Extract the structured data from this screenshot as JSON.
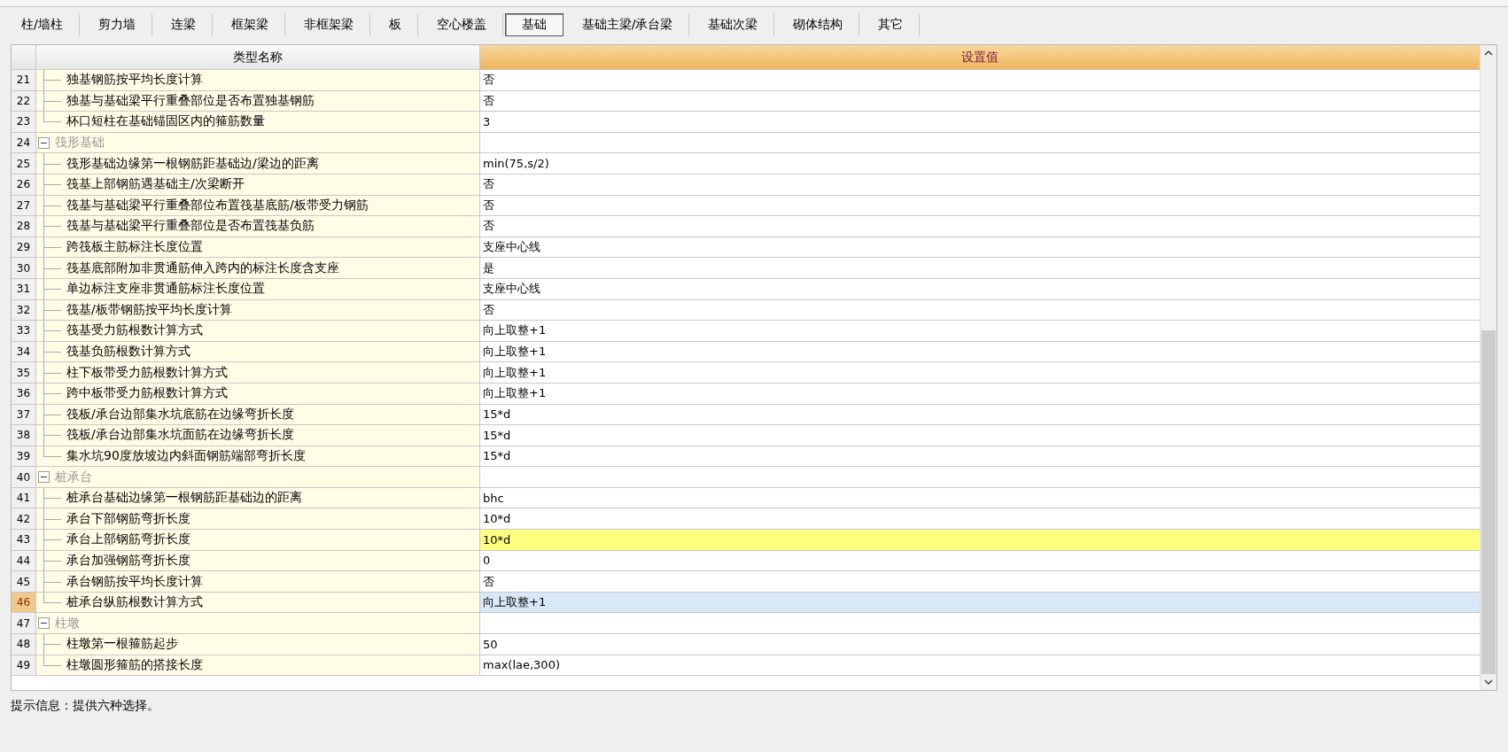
{
  "toolbar_tabs": [
    {
      "label": "柱/墙柱",
      "selected": false
    },
    {
      "label": "剪力墙",
      "selected": false
    },
    {
      "label": "连梁",
      "selected": false
    },
    {
      "label": "框架梁",
      "selected": false
    },
    {
      "label": "非框架梁",
      "selected": false
    },
    {
      "label": "板",
      "selected": false
    },
    {
      "label": "空心楼盖",
      "selected": false
    },
    {
      "label": "基础",
      "selected": true
    },
    {
      "label": "基础主梁/承台梁",
      "selected": false
    },
    {
      "label": "基础次梁",
      "selected": false
    },
    {
      "label": "砌体结构",
      "selected": false
    },
    {
      "label": "其它",
      "selected": false
    }
  ],
  "table": {
    "columns": [
      "类型名称",
      "设置值"
    ],
    "rows": [
      {
        "kind": "item",
        "number": "21",
        "name": "独基钢筋按平均长度计算",
        "value": "否",
        "selected": false,
        "highlighted": false
      },
      {
        "kind": "item",
        "number": "22",
        "name": "独基与基础梁平行重叠部位是否布置独基钢筋",
        "value": "否",
        "selected": false,
        "highlighted": false
      },
      {
        "kind": "item",
        "number": "23",
        "name": "杯口短柱在基础锚固区内的箍筋数量",
        "value": "3",
        "selected": false,
        "highlighted": false
      },
      {
        "kind": "group",
        "number": "24",
        "name": "筏形基础",
        "expanded": true,
        "selected": false,
        "children": [
          {
            "kind": "item",
            "number": "25",
            "name": "筏形基础边缘第一根钢筋距基础边/梁边的距离",
            "value": "min(75,s/2)",
            "selected": false,
            "highlighted": false
          },
          {
            "kind": "item",
            "number": "26",
            "name": "筏基上部钢筋遇基础主/次梁断开",
            "value": "否",
            "selected": false,
            "highlighted": false
          },
          {
            "kind": "item",
            "number": "27",
            "name": "筏基与基础梁平行重叠部位布置筏基底筋/板带受力钢筋",
            "value": "否",
            "selected": false,
            "highlighted": false
          },
          {
            "kind": "item",
            "number": "28",
            "name": "筏基与基础梁平行重叠部位是否布置筏基负筋",
            "value": "否",
            "selected": false,
            "highlighted": false
          },
          {
            "kind": "item",
            "number": "29",
            "name": "跨筏板主筋标注长度位置",
            "value": "支座中心线",
            "selected": false,
            "highlighted": false
          },
          {
            "kind": "item",
            "number": "30",
            "name": "筏基底部附加非贯通筋伸入跨内的标注长度含支座",
            "value": "是",
            "selected": false,
            "highlighted": false
          },
          {
            "kind": "item",
            "number": "31",
            "name": "单边标注支座非贯通筋标注长度位置",
            "value": "支座中心线",
            "selected": false,
            "highlighted": false
          },
          {
            "kind": "item",
            "number": "32",
            "name": "筏基/板带钢筋按平均长度计算",
            "value": "否",
            "selected": false,
            "highlighted": false
          },
          {
            "kind": "item",
            "number": "33",
            "name": "筏基受力筋根数计算方式",
            "value": "向上取整+1",
            "selected": false,
            "highlighted": false
          },
          {
            "kind": "item",
            "number": "34",
            "name": "筏基负筋根数计算方式",
            "value": "向上取整+1",
            "selected": false,
            "highlighted": false
          },
          {
            "kind": "item",
            "number": "35",
            "name": "柱下板带受力筋根数计算方式",
            "value": "向上取整+1",
            "selected": false,
            "highlighted": false
          },
          {
            "kind": "item",
            "number": "36",
            "name": "跨中板带受力筋根数计算方式",
            "value": "向上取整+1",
            "selected": false,
            "highlighted": false
          },
          {
            "kind": "item",
            "number": "37",
            "name": "筏板/承台边部集水坑底筋在边缘弯折长度",
            "value": "15*d",
            "selected": false,
            "highlighted": false
          },
          {
            "kind": "item",
            "number": "38",
            "name": "筏板/承台边部集水坑面筋在边缘弯折长度",
            "value": "15*d",
            "selected": false,
            "highlighted": false
          },
          {
            "kind": "item",
            "number": "39",
            "name": "集水坑90度放坡边内斜面钢筋端部弯折长度",
            "value": "15*d",
            "selected": false,
            "highlighted": false
          }
        ]
      },
      {
        "kind": "group",
        "number": "40",
        "name": "桩承台",
        "expanded": true,
        "selected": false,
        "children": [
          {
            "kind": "item",
            "number": "41",
            "name": "桩承台基础边缘第一根钢筋距基础边的距离",
            "value": "bhc",
            "selected": false,
            "highlighted": false
          },
          {
            "kind": "item",
            "number": "42",
            "name": "承台下部钢筋弯折长度",
            "value": "10*d",
            "selected": false,
            "highlighted": false
          },
          {
            "kind": "item",
            "number": "43",
            "name": "承台上部钢筋弯折长度",
            "value": "10*d",
            "selected": false,
            "highlighted": true
          },
          {
            "kind": "item",
            "number": "44",
            "name": "承台加强钢筋弯折长度",
            "value": "0",
            "selected": false,
            "highlighted": false
          },
          {
            "kind": "item",
            "number": "45",
            "name": "承台钢筋按平均长度计算",
            "value": "否",
            "selected": false,
            "highlighted": false
          },
          {
            "kind": "item",
            "number": "46",
            "name": "桩承台纵筋根数计算方式",
            "value": "向上取整+1",
            "selected": true,
            "highlighted": false
          }
        ]
      },
      {
        "kind": "group",
        "number": "47",
        "name": "柱墩",
        "expanded": true,
        "selected": false,
        "children": [
          {
            "kind": "item",
            "number": "48",
            "name": "柱墩第一根箍筋起步",
            "value": "50",
            "selected": false,
            "highlighted": false
          },
          {
            "kind": "item",
            "number": "49",
            "name": "柱墩圆形箍筋的搭接长度",
            "value": "max(lae,300)",
            "selected": false,
            "highlighted": false
          }
        ]
      }
    ]
  },
  "hint": "提示信息：提供六种选择。"
}
